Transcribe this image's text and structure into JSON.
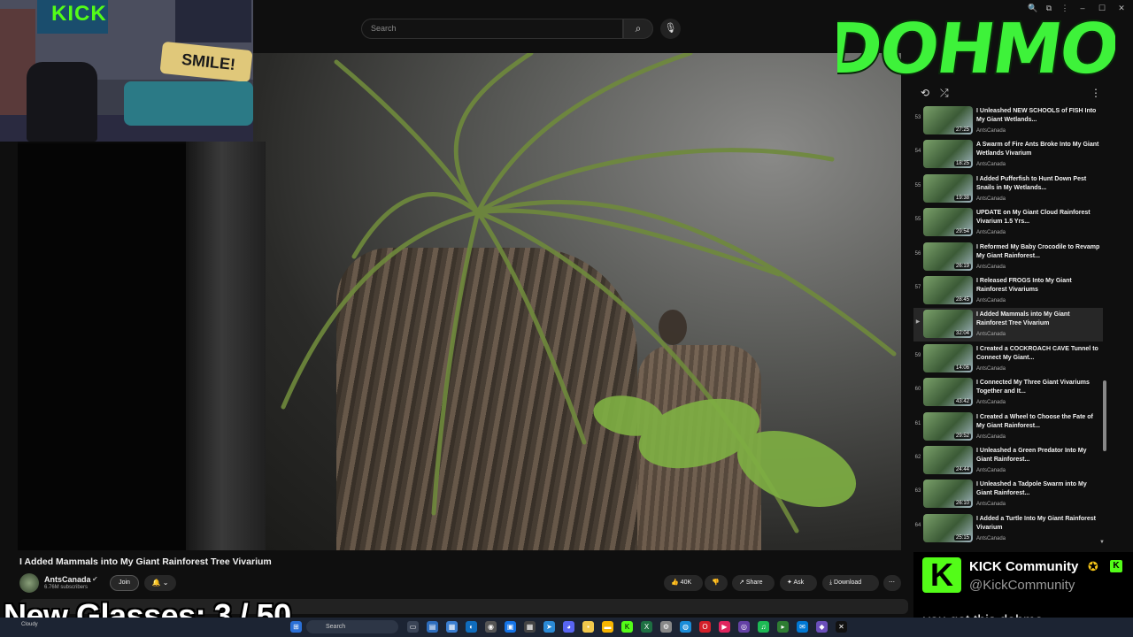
{
  "search": {
    "placeholder": "Search"
  },
  "window_controls": [
    "🔍",
    "⧉",
    "⋮",
    "–",
    "☐",
    "✕"
  ],
  "webcam": {
    "flag_text": "KICK",
    "sign_text": "SMILE!"
  },
  "video": {
    "title": "I Added Mammals into My Giant Rainforest Tree Vivarium",
    "channel": "AntsCanada",
    "subscribers": "6.76M subscribers",
    "join_label": "Join",
    "likes": "40K",
    "share_label": "Share",
    "ask_label": "Ask",
    "download_label": "Download"
  },
  "overlay": {
    "glasses_counter": "New Glasses:  3 / 50"
  },
  "playlist": {
    "items": [
      {
        "num": "53",
        "title": "I Unleashed NEW SCHOOLS of FISH Into My Giant Wetlands...",
        "channel": "AntsCanada",
        "duration": "27:25",
        "active": false
      },
      {
        "num": "54",
        "title": "A Swarm of Fire Ants Broke Into My Giant Wetlands Vivarium",
        "channel": "AntsCanada",
        "duration": "18:25",
        "active": false
      },
      {
        "num": "55",
        "title": "I Added Pufferfish to Hunt Down Pest Snails in My Wetlands...",
        "channel": "AntsCanada",
        "duration": "19:38",
        "active": false
      },
      {
        "num": "55",
        "title": "UPDATE on My Giant Cloud Rainforest Vivarium 1.5 Yrs...",
        "channel": "AntsCanada",
        "duration": "29:54",
        "active": false
      },
      {
        "num": "56",
        "title": "I Reformed My Baby Crocodile to Revamp My Giant Rainforest...",
        "channel": "AntsCanada",
        "duration": "26:19",
        "active": false
      },
      {
        "num": "57",
        "title": "I Released FROGS Into My Giant Rainforest Vivariums",
        "channel": "AntsCanada",
        "duration": "28:45",
        "active": false
      },
      {
        "num": "▶",
        "title": "I Added Mammals into My Giant Rainforest Tree Vivarium",
        "channel": "AntsCanada",
        "duration": "32:04",
        "active": true
      },
      {
        "num": "59",
        "title": "I Created a COCKROACH CAVE Tunnel to Connect My Giant...",
        "channel": "AntsCanada",
        "duration": "14:06",
        "active": false
      },
      {
        "num": "60",
        "title": "I Connected My Three Giant Vivariums Together and It...",
        "channel": "AntsCanada",
        "duration": "43:42",
        "active": false
      },
      {
        "num": "61",
        "title": "I Created a Wheel to Choose the Fate of My Giant Rainforest...",
        "channel": "AntsCanada",
        "duration": "29:52",
        "active": false
      },
      {
        "num": "62",
        "title": "I Unleashed a Green Predator Into My Giant Rainforest...",
        "channel": "AntsCanada",
        "duration": "24:44",
        "active": false
      },
      {
        "num": "63",
        "title": "I Unleashed a Tadpole Swarm into My Giant Rainforest...",
        "channel": "AntsCanada",
        "duration": "26:10",
        "active": false
      },
      {
        "num": "64",
        "title": "I Added a Turtle Into My Giant Rainforest Vivarium",
        "channel": "AntsCanada",
        "duration": "25:15",
        "active": false
      }
    ]
  },
  "logo": {
    "text": "DOHMO",
    "color": "#3ef23a"
  },
  "kick_chat": {
    "name": "KICK Community",
    "handle": "@KickCommunity",
    "message": "you got this dohmo",
    "brand_color": "#53fc18"
  },
  "taskbar": {
    "search_label": "Search",
    "weather": "Cloudy"
  }
}
